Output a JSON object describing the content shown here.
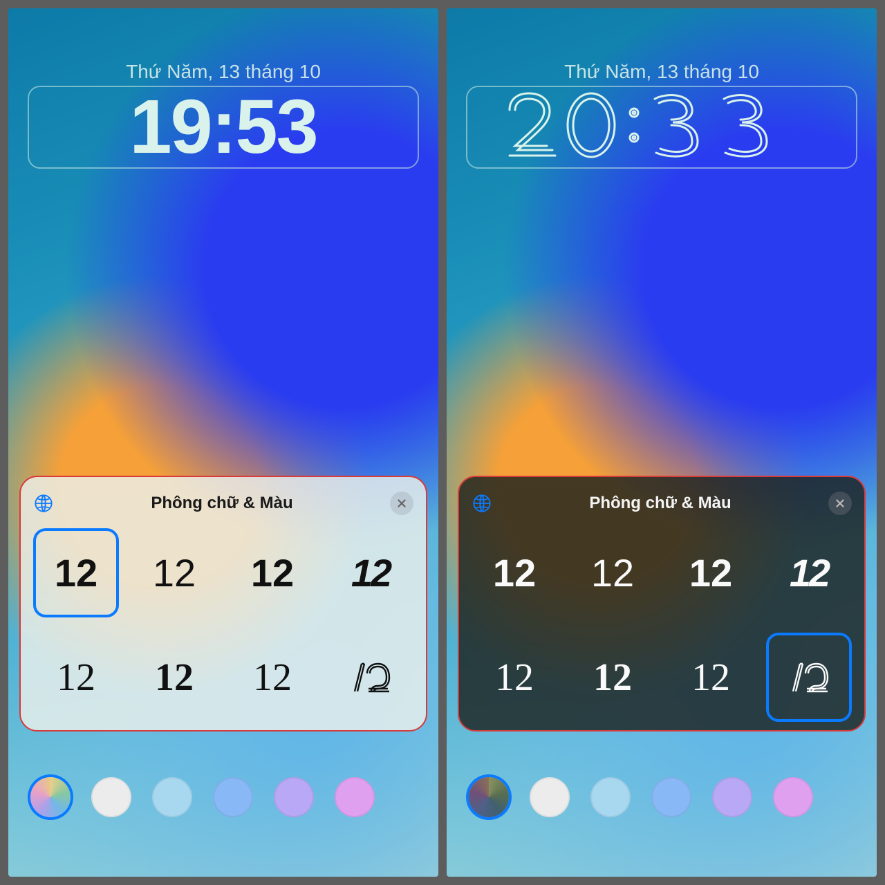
{
  "left": {
    "date": "Thứ Năm, 13 tháng 10",
    "time": "19:53",
    "panel_title": "Phông chữ & Màu",
    "fonts": {
      "sample": "12",
      "selected_index": 0
    },
    "panel_theme": "light",
    "colors": [
      {
        "value": "gradient-multi",
        "selected": true
      },
      {
        "value": "#e8e8e8"
      },
      {
        "value": "#a8d8f0"
      },
      {
        "value": "#88b8f5"
      },
      {
        "value": "#b8a8f5"
      },
      {
        "value": "#e0a0f0"
      }
    ]
  },
  "right": {
    "date": "Thứ Năm, 13 tháng 10",
    "time": "20:33",
    "panel_title": "Phông chữ & Màu",
    "fonts": {
      "sample": "12",
      "selected_index": 7
    },
    "panel_theme": "dark",
    "colors": [
      {
        "value": "gradient-multi",
        "selected": true
      },
      {
        "value": "#e8e8e8"
      },
      {
        "value": "#a8d8f0"
      },
      {
        "value": "#88b8f5"
      },
      {
        "value": "#b8a8f5"
      },
      {
        "value": "#e0a0f0"
      }
    ]
  },
  "icons": {
    "globe": "globe-icon",
    "close": "close-icon"
  }
}
